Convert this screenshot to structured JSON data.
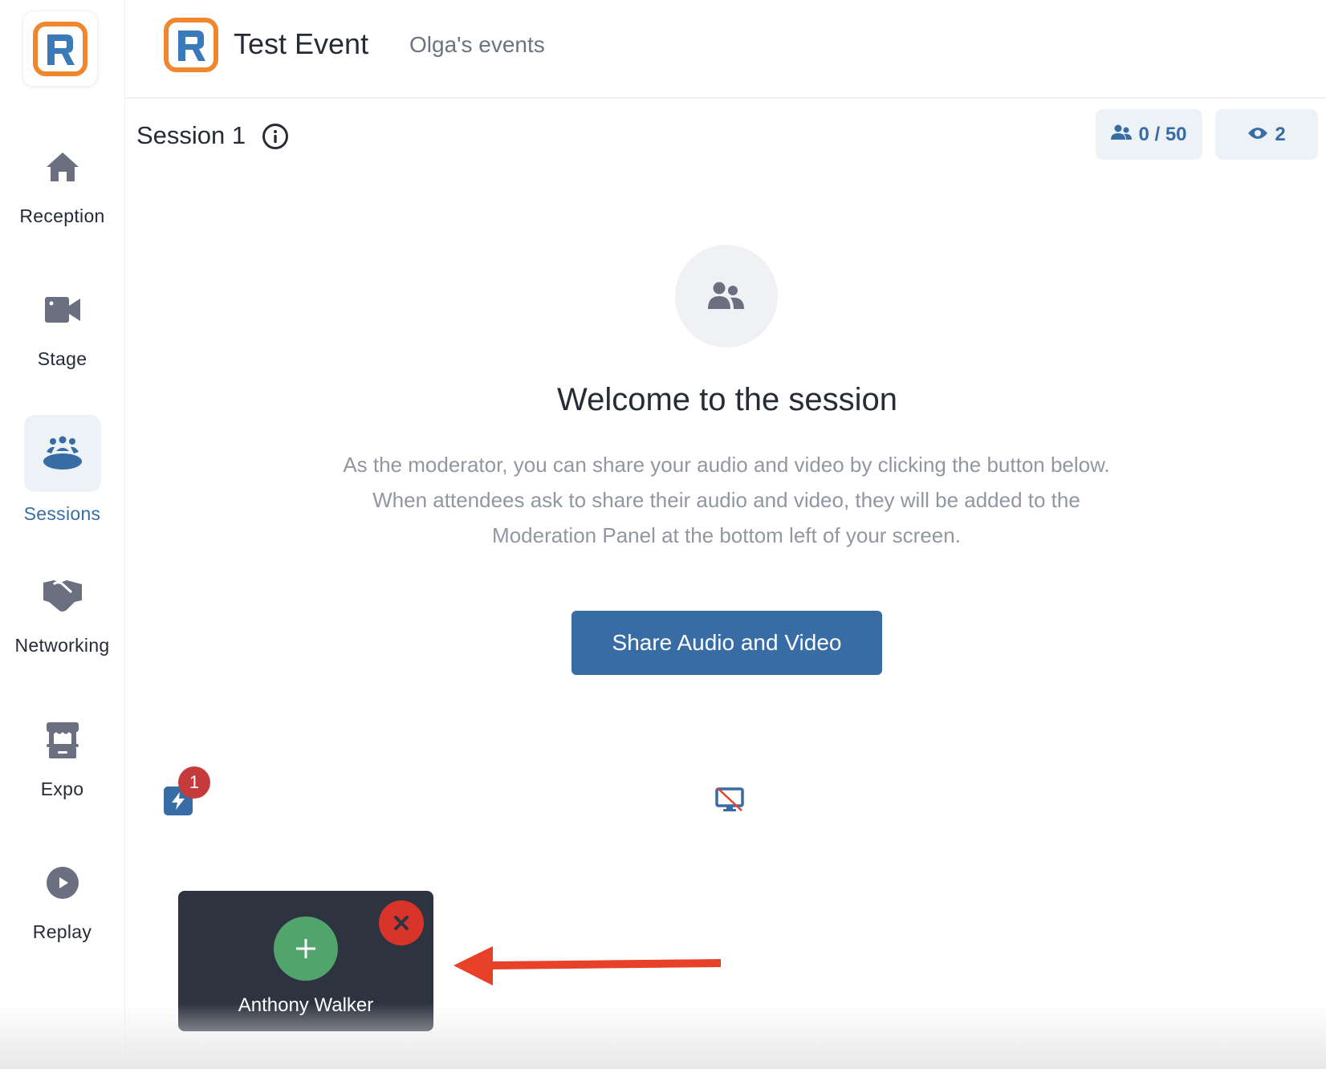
{
  "app": {
    "logo_icon": "r-logo-icon",
    "brand_colors": {
      "orange": "#f0872f",
      "blue": "#3a7ab8",
      "primary": "#386ca4"
    }
  },
  "sidebar": {
    "items": [
      {
        "label": "Reception",
        "icon": "home-icon",
        "active": false
      },
      {
        "label": "Stage",
        "icon": "video-camera-icon",
        "active": false
      },
      {
        "label": "Sessions",
        "icon": "sessions-table-icon",
        "active": true
      },
      {
        "label": "Networking",
        "icon": "handshake-icon",
        "active": false
      },
      {
        "label": "Expo",
        "icon": "booth-icon",
        "active": false
      },
      {
        "label": "Replay",
        "icon": "play-circle-icon",
        "active": false
      }
    ]
  },
  "header": {
    "event_title": "Test Event",
    "organization": "Olga's events"
  },
  "session": {
    "title": "Session 1",
    "info_icon": "info-circle-icon",
    "attendee_count": "0 / 50",
    "viewer_count": "2"
  },
  "welcome": {
    "icon": "users-icon",
    "heading": "Welcome to the session",
    "description": "As the moderator, you can share your audio and video by clicking the button below. When attendees ask to share their audio and video, they will be added to the Moderation Panel at the bottom left of your screen.",
    "share_button_label": "Share Audio and Video"
  },
  "moderation": {
    "request_badge_count": "1",
    "bolt_icon": "lightning-icon",
    "screen_share_icon": "screen-share-off-icon",
    "requests": [
      {
        "name": "Anthony Walker"
      }
    ]
  },
  "annotation": {
    "arrow_color": "#e8412a"
  }
}
